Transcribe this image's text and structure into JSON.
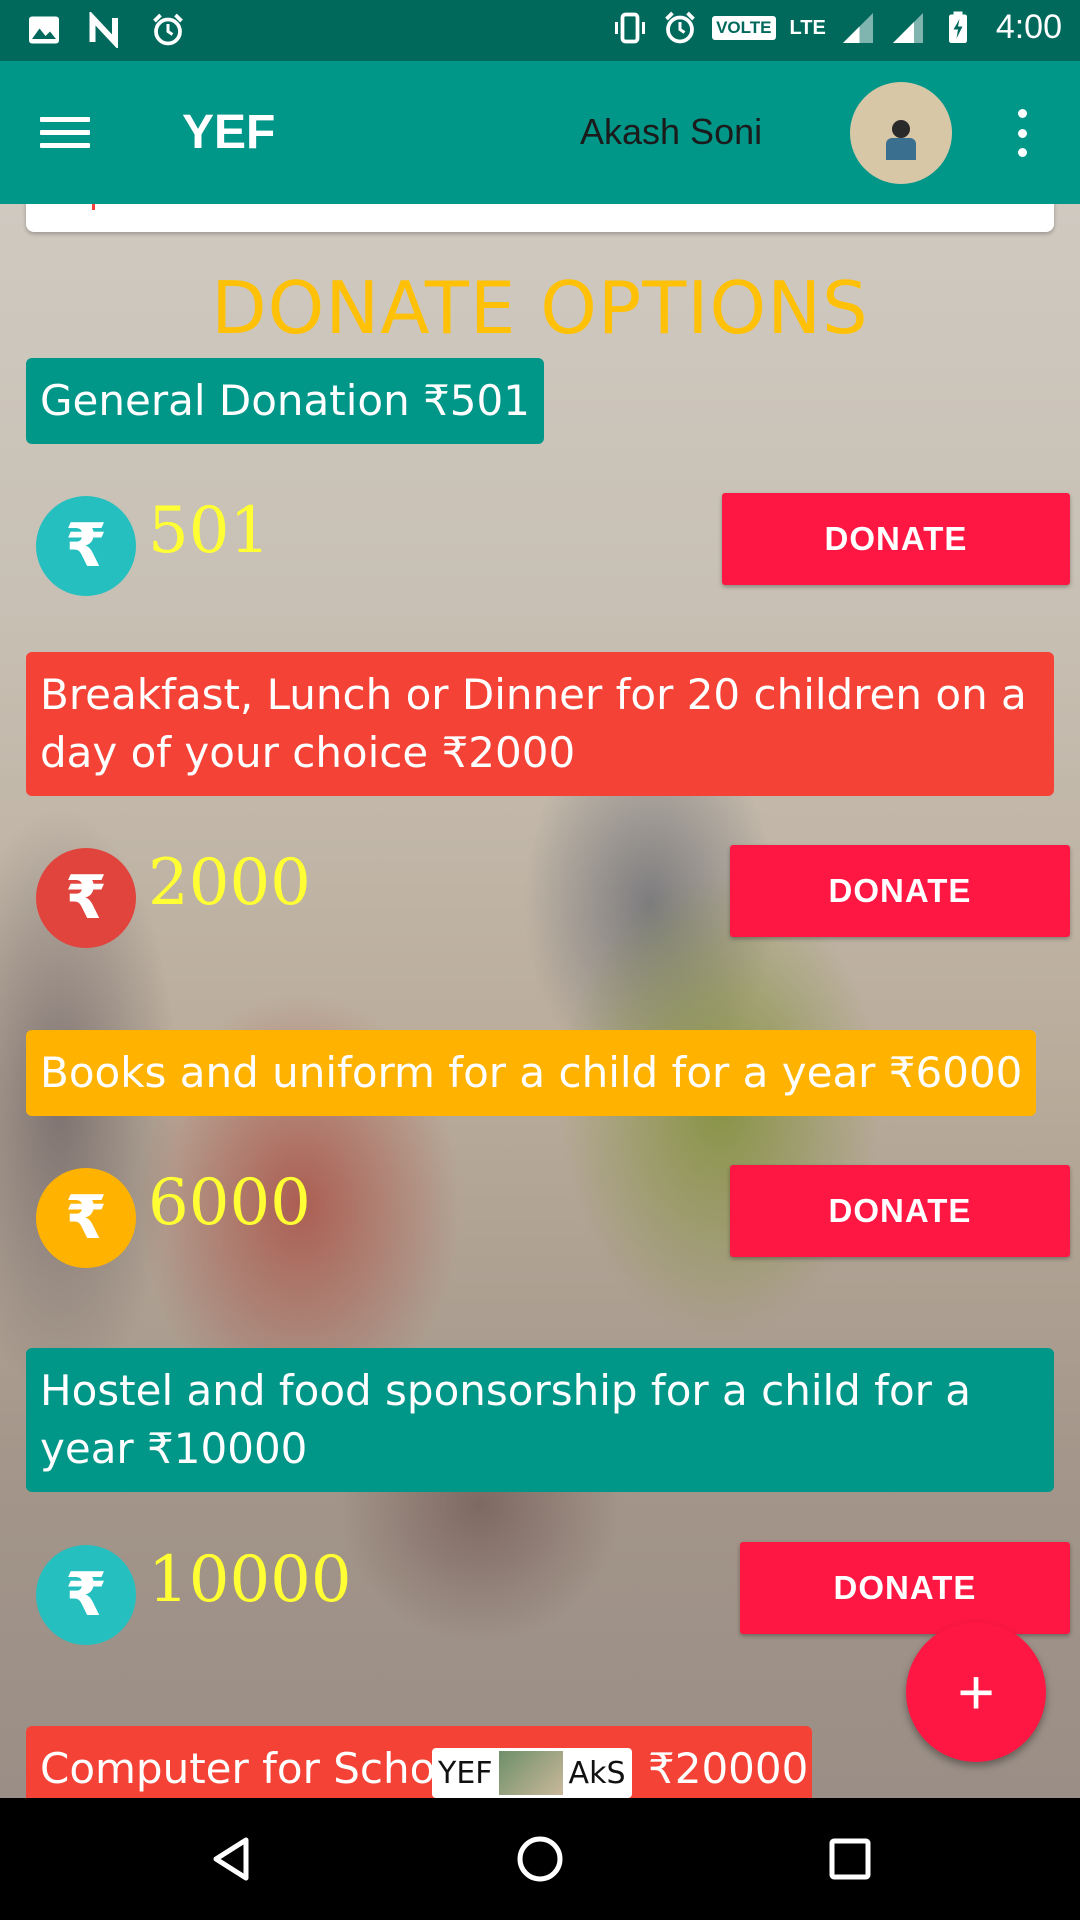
{
  "status_bar": {
    "time": "4:00",
    "volte": "VOLTE",
    "lte": "LTE",
    "icons": [
      "image-icon",
      "n-icon",
      "alarm-icon",
      "vibrate-icon",
      "alarm-icon",
      "signal-icon",
      "signal-icon",
      "battery-charging-icon"
    ]
  },
  "app_bar": {
    "title": "YEF",
    "user_name": "Akash Soni",
    "icons": [
      "menu-icon",
      "avatar",
      "more-vert-icon"
    ]
  },
  "section_title": "DONATE OPTIONS",
  "options": [
    {
      "label": "General Donation  ₹501",
      "amount": "501",
      "button": "DONATE",
      "color": "#009688"
    },
    {
      "label": "Breakfast, Lunch or Dinner for 20 children on a day of your choice  ₹2000",
      "amount": "2000",
      "button": "DONATE",
      "color": "#f44336"
    },
    {
      "label": "Books and uniform for a child for a year  ₹6000",
      "amount": "6000",
      "button": "DONATE",
      "color": "#ffb300"
    },
    {
      "label": "Hostel and food sponsorship for a child for a year  ₹10000",
      "amount": "10000",
      "button": "DONATE",
      "color": "#009688"
    },
    {
      "label": "Computer for Schoo",
      "label_tail": "₹20000"
    }
  ],
  "rupee_symbol": "₹",
  "fab": {
    "label": "+"
  },
  "watermark": {
    "left": "YEF",
    "right": "AkS"
  },
  "colors": {
    "accent": "#ff1744",
    "primary": "#009688",
    "status_bar": "#00695c",
    "title": "#ffc107",
    "amount": "#ffff33"
  },
  "nav_bar": {
    "icons": [
      "back-icon",
      "home-icon",
      "recents-icon"
    ]
  }
}
